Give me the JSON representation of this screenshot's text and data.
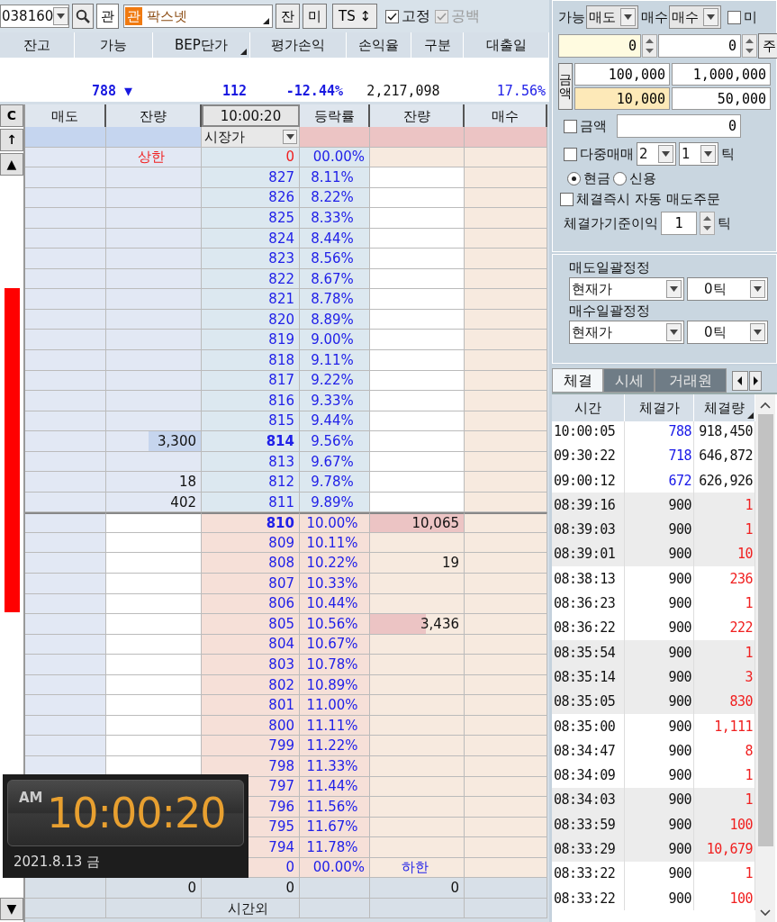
{
  "toolbar": {
    "stock_code": "038160",
    "market_button": "관",
    "badge": "관",
    "stock_name": "팍스넷",
    "buttons": [
      "잔",
      "미",
      "TS ↕"
    ],
    "checks": [
      {
        "label": "고정",
        "checked": true,
        "disabled": false
      },
      {
        "label": "공백",
        "checked": true,
        "disabled": true
      }
    ]
  },
  "account": {
    "columns": [
      "잔고",
      "가능",
      "BEP단가",
      "평가손익",
      "손익율",
      "구분",
      "대출일"
    ],
    "values": [
      {
        "text": "788 ▼",
        "kind": "strong"
      },
      {
        "text": "112",
        "kind": "strong"
      },
      {
        "text": "-12.44%",
        "kind": "strong"
      },
      {
        "text": "2,217,098",
        "kind": "plain"
      },
      {
        "text": "17.56%",
        "kind": "rate"
      }
    ]
  },
  "orderbook": {
    "columns": [
      "매도",
      "잔량",
      "10:00:20",
      "등락률",
      "잔량",
      "매수"
    ],
    "side_buttons": [
      "C",
      "↑",
      "▲"
    ],
    "bottom_button": "▼",
    "rows": [
      {
        "kind": "market",
        "price": "시장가"
      },
      {
        "kind": "upper",
        "ask_qty": "상한",
        "price": "0",
        "rate": "00.00%"
      },
      {
        "kind": "ask",
        "price": "827",
        "rate": "8.11%",
        "emphasized": false
      },
      {
        "kind": "ask",
        "price": "826",
        "rate": "8.22%",
        "emphasized": false
      },
      {
        "kind": "ask",
        "price": "825",
        "rate": "8.33%",
        "emphasized": false
      },
      {
        "kind": "ask",
        "price": "824",
        "rate": "8.44%",
        "emphasized": false
      },
      {
        "kind": "ask",
        "price": "823",
        "rate": "8.56%",
        "emphasized": false
      },
      {
        "kind": "ask",
        "price": "822",
        "rate": "8.67%",
        "emphasized": false
      },
      {
        "kind": "ask",
        "price": "821",
        "rate": "8.78%",
        "emphasized": false
      },
      {
        "kind": "ask",
        "price": "820",
        "rate": "8.89%",
        "emphasized": false
      },
      {
        "kind": "ask",
        "price": "819",
        "rate": "9.00%",
        "emphasized": false
      },
      {
        "kind": "ask",
        "price": "818",
        "rate": "9.11%",
        "emphasized": false
      },
      {
        "kind": "ask",
        "price": "817",
        "rate": "9.22%",
        "emphasized": false
      },
      {
        "kind": "ask",
        "price": "816",
        "rate": "9.33%",
        "emphasized": false
      },
      {
        "kind": "ask",
        "price": "815",
        "rate": "9.44%",
        "emphasized": false
      },
      {
        "kind": "ask",
        "price": "814",
        "rate": "9.56%",
        "emphasized": true,
        "ask_qty": "3,300",
        "level": 0.55
      },
      {
        "kind": "ask",
        "price": "813",
        "rate": "9.67%",
        "emphasized": false
      },
      {
        "kind": "ask",
        "price": "812",
        "rate": "9.78%",
        "emphasized": false,
        "ask_qty": "18"
      },
      {
        "kind": "ask",
        "price": "811",
        "rate": "9.89%",
        "emphasized": false,
        "ask_qty": "402"
      },
      {
        "kind": "bid",
        "price": "810",
        "rate": "10.00%",
        "emphasized": true,
        "bid_qty": "10,065",
        "level": 1
      },
      {
        "kind": "bid",
        "price": "809",
        "rate": "10.11%",
        "emphasized": false
      },
      {
        "kind": "bid",
        "price": "808",
        "rate": "10.22%",
        "emphasized": false,
        "bid_qty": "19"
      },
      {
        "kind": "bid",
        "price": "807",
        "rate": "10.33%",
        "emphasized": false
      },
      {
        "kind": "bid",
        "price": "806",
        "rate": "10.44%",
        "emphasized": false
      },
      {
        "kind": "bid",
        "price": "805",
        "rate": "10.56%",
        "emphasized": false,
        "bid_qty": "3,436",
        "level": 0.6
      },
      {
        "kind": "bid",
        "price": "804",
        "rate": "10.67%",
        "emphasized": false
      },
      {
        "kind": "bid",
        "price": "803",
        "rate": "10.78%",
        "emphasized": false
      },
      {
        "kind": "bid",
        "price": "802",
        "rate": "10.89%",
        "emphasized": false
      },
      {
        "kind": "bid",
        "price": "801",
        "rate": "11.00%",
        "emphasized": false
      },
      {
        "kind": "bid",
        "price": "800",
        "rate": "11.11%",
        "emphasized": false
      },
      {
        "kind": "bid",
        "price": "799",
        "rate": "11.22%",
        "emphasized": false
      },
      {
        "kind": "bid",
        "price": "798",
        "rate": "11.33%",
        "emphasized": false
      },
      {
        "kind": "bid",
        "price": "797",
        "rate": "11.44%",
        "emphasized": false
      },
      {
        "kind": "bid",
        "price": "796",
        "rate": "11.56%",
        "emphasized": false
      },
      {
        "kind": "bid",
        "price": "795",
        "rate": "11.67%",
        "emphasized": false
      },
      {
        "kind": "bid",
        "price": "794",
        "rate": "11.78%",
        "emphasized": false
      },
      {
        "kind": "lower",
        "price": "0",
        "rate": "00.00%",
        "bid_qty": "하한"
      },
      {
        "kind": "total",
        "ask_qty": "0",
        "price": "0",
        "bid_qty": "0"
      },
      {
        "kind": "afterhours",
        "price": "시간외"
      }
    ]
  },
  "clock": {
    "meridiem": "AM",
    "time": "10:00:20",
    "date": "2021.8.13 금"
  },
  "settings": {
    "able_label": "가능",
    "sell_select": "매도",
    "buy_label": "매수",
    "buy_select": "매수",
    "mi_check": {
      "label": "미",
      "checked": false
    },
    "qty_inputs": [
      {
        "value": "0",
        "selected": true
      },
      {
        "value": "0",
        "selected": false
      }
    ],
    "unit_button": "주",
    "amount_button": "금액",
    "amount_presets": [
      {
        "value": "100,000",
        "selected": false
      },
      {
        "value": "1,000,000",
        "selected": false
      },
      {
        "value": "10,000",
        "selected": true
      },
      {
        "value": "50,000",
        "selected": false
      }
    ],
    "amount_check": {
      "label": "금액",
      "checked": false
    },
    "amount_value": "0",
    "multi_check": {
      "label": "다중매매",
      "checked": false
    },
    "multi_selects": [
      "2",
      "1"
    ],
    "multi_unit": "틱",
    "credit_options": [
      {
        "label": "현금",
        "selected": true
      },
      {
        "label": "신용",
        "selected": false
      }
    ],
    "auto_sell": {
      "label": "체결즉시 자동 매도주문",
      "checked": false
    },
    "profit_label": "체결가기준이익",
    "profit_value": "1",
    "profit_unit": "틱"
  },
  "bulk": [
    {
      "label": "매도일괄정정",
      "price_select": "현재가",
      "tick_select": "0틱"
    },
    {
      "label": "매수일괄정정",
      "price_select": "현재가",
      "tick_select": "0틱"
    }
  ],
  "trades": {
    "tabs": [
      {
        "label": "체결",
        "selected": true
      },
      {
        "label": "시세",
        "selected": false
      },
      {
        "label": "거래원",
        "selected": false
      }
    ],
    "columns": [
      "시간",
      "체결가",
      "체결량"
    ],
    "rows": [
      {
        "time": "10:00:05",
        "price": "788",
        "volume": "918,450",
        "kind": "regular"
      },
      {
        "time": "09:30:22",
        "price": "718",
        "volume": "646,872",
        "kind": "regular"
      },
      {
        "time": "09:00:12",
        "price": "672",
        "volume": "626,926",
        "kind": "regular"
      },
      {
        "time": "08:39:16",
        "price": "900",
        "volume": "1",
        "kind": "premarket"
      },
      {
        "time": "08:39:03",
        "price": "900",
        "volume": "1",
        "kind": "premarket"
      },
      {
        "time": "08:39:01",
        "price": "900",
        "volume": "10",
        "kind": "premarket"
      },
      {
        "time": "08:38:13",
        "price": "900",
        "volume": "236",
        "kind": "premarket"
      },
      {
        "time": "08:36:23",
        "price": "900",
        "volume": "1",
        "kind": "premarket"
      },
      {
        "time": "08:36:22",
        "price": "900",
        "volume": "222",
        "kind": "premarket"
      },
      {
        "time": "08:35:54",
        "price": "900",
        "volume": "1",
        "kind": "premarket"
      },
      {
        "time": "08:35:14",
        "price": "900",
        "volume": "3",
        "kind": "premarket"
      },
      {
        "time": "08:35:05",
        "price": "900",
        "volume": "830",
        "kind": "premarket"
      },
      {
        "time": "08:35:00",
        "price": "900",
        "volume": "1,111",
        "kind": "premarket"
      },
      {
        "time": "08:34:47",
        "price": "900",
        "volume": "8",
        "kind": "premarket"
      },
      {
        "time": "08:34:09",
        "price": "900",
        "volume": "1",
        "kind": "premarket"
      },
      {
        "time": "08:34:03",
        "price": "900",
        "volume": "1",
        "kind": "premarket"
      },
      {
        "time": "08:33:59",
        "price": "900",
        "volume": "100",
        "kind": "premarket"
      },
      {
        "time": "08:33:29",
        "price": "900",
        "volume": "10,679",
        "kind": "premarket"
      },
      {
        "time": "08:33:22",
        "price": "900",
        "volume": "1",
        "kind": "premarket"
      },
      {
        "time": "08:33:22",
        "price": "900",
        "volume": "100",
        "kind": "premarket"
      }
    ]
  }
}
